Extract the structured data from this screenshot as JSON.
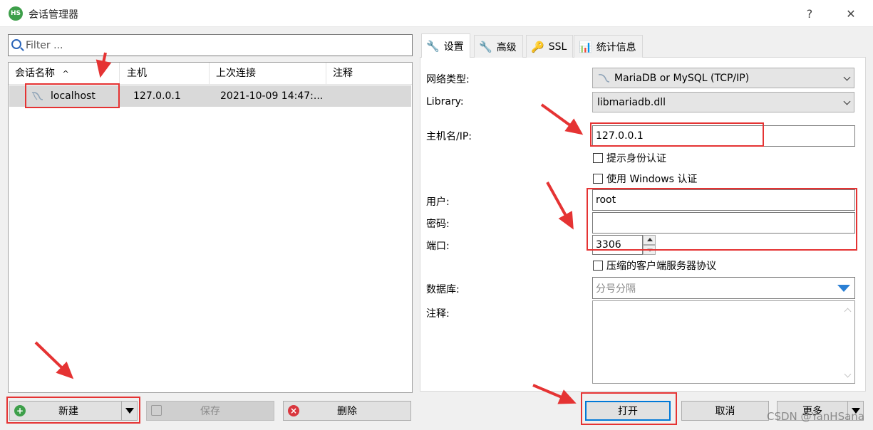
{
  "window": {
    "title": "会话管理器",
    "help": "?",
    "close": "✕",
    "app_icon_text": "HS"
  },
  "filter": {
    "placeholder": "Filter ..."
  },
  "list": {
    "headers": [
      "会话名称",
      "主机",
      "上次连接",
      "注释"
    ],
    "sort_indicator": "^",
    "rows": [
      {
        "name": "localhost",
        "host": "127.0.0.1",
        "last_connect": "2021-10-09 14:47:...",
        "comment": ""
      }
    ]
  },
  "buttons": {
    "new": "新建",
    "save": "保存",
    "delete": "删除",
    "open": "打开",
    "cancel": "取消",
    "more": "更多"
  },
  "tabs": [
    "设置",
    "高级",
    "SSL",
    "统计信息"
  ],
  "settings": {
    "network_type_label": "网络类型:",
    "network_type_value": "MariaDB or MySQL (TCP/IP)",
    "library_label": "Library:",
    "library_value": "libmariadb.dll",
    "host_label": "主机名/IP:",
    "host_value": "127.0.0.1",
    "prompt_auth": "提示身份认证",
    "windows_auth": "使用 Windows 认证",
    "user_label": "用户:",
    "user_value": "root",
    "password_label": "密码:",
    "password_value": "",
    "port_label": "端口:",
    "port_value": "3306",
    "compress": "压缩的客户端服务器协议",
    "database_label": "数据库:",
    "database_placeholder": "分号分隔",
    "comment_label": "注释:"
  },
  "watermark": "CSDN @YanHSana",
  "colors": {
    "highlight": "#e53333",
    "accent_blue": "#2a64b8",
    "new_green": "#3e9f4a",
    "delete_red": "#d9363e"
  }
}
